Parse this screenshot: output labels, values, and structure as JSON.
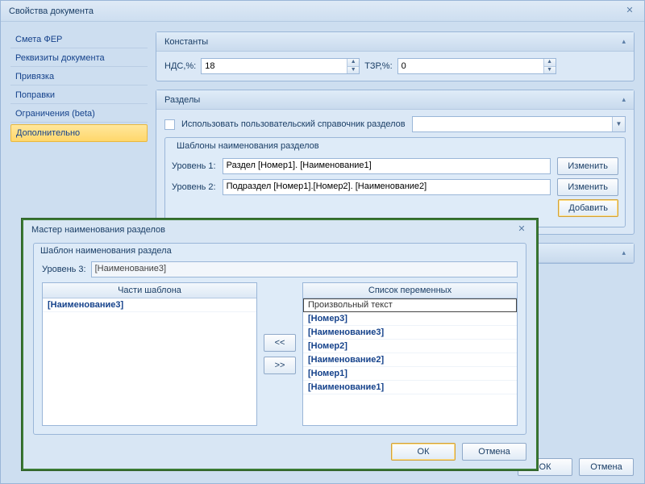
{
  "window": {
    "title": "Свойства документа"
  },
  "sidebar": {
    "items": [
      {
        "label": "Смета ФЕР"
      },
      {
        "label": "Реквизиты документа"
      },
      {
        "label": "Привязка"
      },
      {
        "label": "Поправки"
      },
      {
        "label": "Ограничения (beta)"
      },
      {
        "label": "Дополнительно"
      }
    ]
  },
  "constants": {
    "title": "Константы",
    "nds_label": "НДС,%:",
    "nds_value": "18",
    "tzr_label": "ТЗР,%:",
    "tzr_value": "0"
  },
  "sections": {
    "title": "Разделы",
    "use_custom_label": "Использовать пользовательский справочник разделов",
    "templates_title": "Шаблоны наименования разделов",
    "level1_label": "Уровень 1:",
    "level1_value": "Раздел [Номер1]. [Наименование1]",
    "level2_label": "Уровень 2:",
    "level2_value": "Подраздел [Номер1].[Номер2]. [Наименование2]",
    "edit_btn": "Изменить",
    "add_btn": "Добавить"
  },
  "wizard": {
    "title": "Мастер наименования разделов",
    "group_title": "Шаблон наименования раздела",
    "level_label": "Уровень 3:",
    "level_value": "[Наименование3]",
    "parts_header": "Части шаблона",
    "vars_header": "Список переменных",
    "parts": [
      {
        "label": "[Наименование3]"
      }
    ],
    "vars": [
      {
        "label": "Произвольный текст",
        "plain": true
      },
      {
        "label": "[Номер3]"
      },
      {
        "label": "[Наименование3]"
      },
      {
        "label": "[Номер2]"
      },
      {
        "label": "[Наименование2]"
      },
      {
        "label": "[Номер1]"
      },
      {
        "label": "[Наименование1]"
      }
    ],
    "move_left": "<<",
    "move_right": ">>",
    "ok": "ОК",
    "cancel": "Отмена"
  },
  "footer": {
    "ok": "ОК",
    "cancel": "Отмена"
  }
}
